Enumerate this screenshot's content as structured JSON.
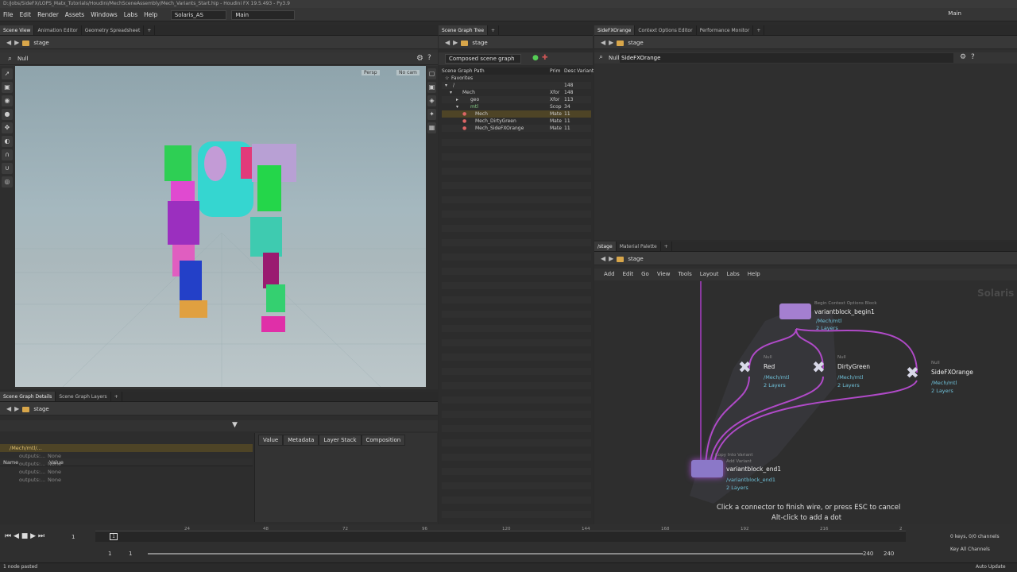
{
  "window": {
    "title": "D:/Jobs/SideFX/LOPS_Matx_Tutorials/Houdini/MechSceneAssembly/Mech_Variants_Start.hip - Houdini FX 19.5.493 - Py3.9"
  },
  "menubar": {
    "items": [
      "File",
      "Edit",
      "Render",
      "Assets",
      "Windows",
      "Labs",
      "Help"
    ],
    "desktop": "Solaris_AS",
    "context": "Main",
    "right_label": "Main"
  },
  "viewer": {
    "tabs": [
      "Scene View",
      "Animation Editor",
      "Geometry Spreadsheet"
    ],
    "path": "stage",
    "node_label": "Null",
    "persp": "Persp",
    "cam": "No cam"
  },
  "scenegraph": {
    "tab": "Scene Graph Tree",
    "path": "stage",
    "mode": "Composed scene graph",
    "headers": {
      "path": "Scene Graph Path",
      "prim": "Prim",
      "desc": "Desc",
      "variant": "Variant"
    },
    "rows": [
      {
        "name": "Favorites",
        "type": "",
        "count": ""
      },
      {
        "name": "/",
        "type": "",
        "count": "148"
      },
      {
        "name": "Mech",
        "type": "Xfor",
        "count": "148"
      },
      {
        "name": "geo",
        "type": "Xfor",
        "count": "113"
      },
      {
        "name": "mtl",
        "type": "Scop",
        "count": "34"
      },
      {
        "name": "Mech",
        "type": "Mate",
        "count": "11"
      },
      {
        "name": "Mech_DirtyGreen",
        "type": "Mate",
        "count": "11"
      },
      {
        "name": "Mech_SideFXOrange",
        "type": "Mate",
        "count": "11"
      }
    ]
  },
  "params": {
    "tabs": [
      "SideFXOrange",
      "Context Options Editor",
      "Performance Monitor"
    ],
    "path": "stage",
    "node_type": "Null",
    "node_name": "SideFXOrange"
  },
  "details": {
    "tabs": [
      "Scene Graph Details",
      "Scene Graph Layers"
    ],
    "path": "stage",
    "col_name": "Name",
    "col_value": "Value",
    "sub_tabs": [
      "Value",
      "Metadata",
      "Layer Stack",
      "Composition"
    ],
    "rows": [
      {
        "name": "/Mech/mtl/...",
        "value": ""
      },
      {
        "name": "outputs:...",
        "value": "None"
      },
      {
        "name": "outputs:...",
        "value": "None"
      },
      {
        "name": "outputs:...",
        "value": "None"
      },
      {
        "name": "outputs:...",
        "value": "None"
      }
    ]
  },
  "network": {
    "tabs": [
      "/stage",
      "Material Palette"
    ],
    "path": "stage",
    "menu": [
      "Add",
      "Edit",
      "Go",
      "View",
      "Tools",
      "Layout",
      "Labs",
      "Help"
    ],
    "context_label": "Solaris",
    "nodes": {
      "begin": {
        "type": "Begin Context Options Block",
        "name": "variantblock_begin1",
        "path": "/Mech/mtl",
        "layers": "2 Layers"
      },
      "red": {
        "type": "Null",
        "name": "Red",
        "path": "/Mech/mtl",
        "layers": "2 Layers"
      },
      "dirty": {
        "type": "Null",
        "name": "DirtyGreen",
        "path": "/Mech/mtl",
        "layers": "2 Layers"
      },
      "orange": {
        "type": "Null",
        "name": "SideFXOrange",
        "path": "/Mech/mtl",
        "layers": "2 Layers"
      },
      "end": {
        "type": "Copy Into Variant",
        "type2": "Add Variant",
        "name": "variantblock_end1",
        "path": "/variantblock_end1",
        "layers": "2 Layers"
      }
    },
    "hint1": "Click a connector to finish wire, or press ESC to cancel",
    "hint2": "Alt-click to add a dot"
  },
  "timeline": {
    "ticks": [
      "24",
      "48",
      "72",
      "96",
      "120",
      "144",
      "168",
      "192",
      "216",
      "2"
    ],
    "frame": "1",
    "start": "1",
    "start2": "1",
    "end": "240",
    "end2": "240",
    "keys": "0 keys, 0/0 channels",
    "key_all": "Key All Channels"
  },
  "status": {
    "message": "1 node pasted",
    "update": "Auto Update"
  }
}
